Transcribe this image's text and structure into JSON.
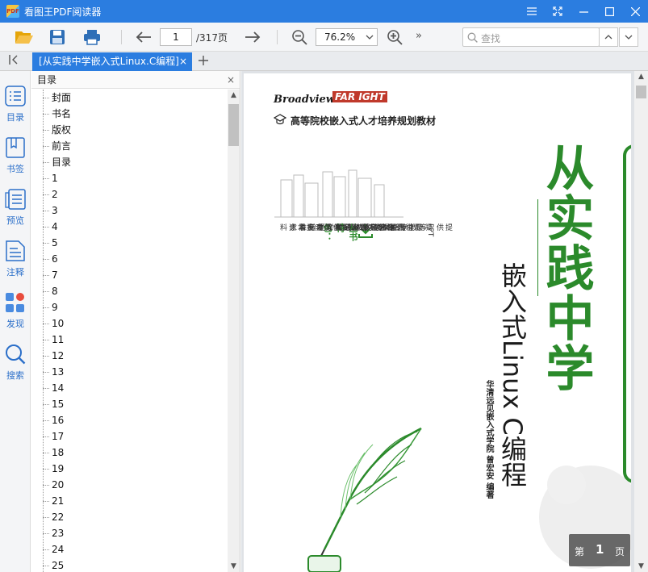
{
  "app": {
    "title": "看图王PDF阅读器",
    "logo_text": "PDF",
    "accent": "#2b7de0"
  },
  "window_controls": {
    "menu_icon": "hamburger-icon",
    "fullscreen_icon": "expand-icon",
    "minimize_icon": "minimize-icon",
    "maximize_icon": "maximize-icon",
    "close_icon": "close-icon"
  },
  "toolbar": {
    "open_icon": "folder-open-icon",
    "save_icon": "save-icon",
    "print_icon": "print-icon",
    "prev_icon": "arrow-left-icon",
    "current_page": "1",
    "total_pages": "/317页",
    "next_icon": "arrow-right-icon",
    "zoom_out_icon": "zoom-out-icon",
    "zoom_value": "76.2%",
    "zoom_in_icon": "zoom-in-icon",
    "more_label": "»",
    "search_placeholder": "查找"
  },
  "tabs": [
    {
      "label": "[从实践中学嵌入式Linux.C编程]",
      "close": "×"
    }
  ],
  "leftnav": [
    {
      "label": "目录",
      "icon": "list-icon"
    },
    {
      "label": "书签",
      "icon": "bookmark-icon"
    },
    {
      "label": "预览",
      "icon": "preview-icon"
    },
    {
      "label": "注释",
      "icon": "annotation-icon"
    },
    {
      "label": "发现",
      "icon": "discover-icon"
    },
    {
      "label": "搜索",
      "icon": "search-icon"
    }
  ],
  "toc": {
    "title": "目录",
    "close": "×",
    "items": [
      "封面",
      "书名",
      "版权",
      "前言",
      "目录",
      "1",
      "2",
      "3",
      "4",
      "5",
      "6",
      "7",
      "8",
      "9",
      "10",
      "11",
      "12",
      "13",
      "14",
      "15",
      "16",
      "17",
      "18",
      "19",
      "20",
      "21",
      "22",
      "23",
      "24",
      "25"
    ]
  },
  "document": {
    "publisher1": "Broadview",
    "publisher2": "FAR IGHT",
    "series": "高等院校嵌入式人才培养规划教材",
    "title": "从实践中学",
    "subtitle": "嵌入式Linux C编程",
    "authors": "华清远见嵌入式学院 曾宏安 编著",
    "feature_title": "丛书特色：",
    "features": [
      "提供PPT等教学相关素材以及",
      "专业视频免费下载",
      "凝聚业内著名讲师一线教学经验",
      "汇总百家知名企业最新人才标准",
      "精选实用案例真实项目需求",
      "结合学习思路提供配套技术资料"
    ]
  },
  "page_indicator": {
    "prefix": "第",
    "number": "1",
    "suffix": "页"
  }
}
